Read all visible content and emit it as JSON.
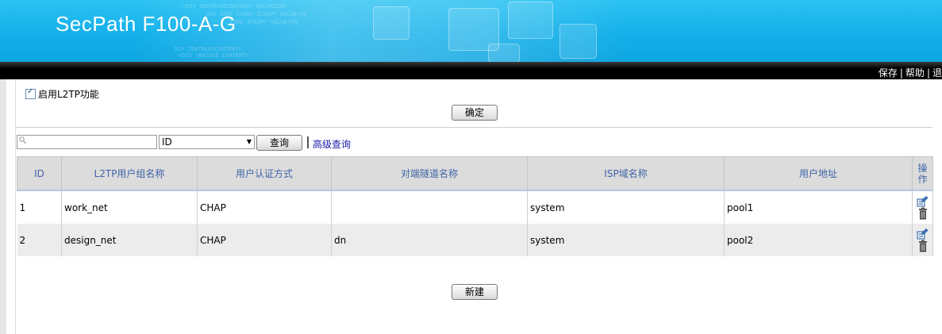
{
  "banner": {
    "product_title": "SecPath F100-A-G"
  },
  "topbar": {
    "links": [
      "保存",
      "帮助",
      "退"
    ]
  },
  "l2tp": {
    "enable_label": "启用L2TP功能",
    "enabled": true,
    "confirm_label": "确定"
  },
  "search": {
    "placeholder": "",
    "field_selected": "ID",
    "query_label": "查询",
    "advanced_label": "高级查询"
  },
  "table": {
    "headers": [
      "ID",
      "L2TP用户组名称",
      "用户认证方式",
      "对端隧道名称",
      "ISP域名称",
      "用户地址",
      "操作"
    ],
    "rows": [
      {
        "id": "1",
        "group": "work_net",
        "auth": "CHAP",
        "tunnel": "",
        "isp": "system",
        "addr": "pool1"
      },
      {
        "id": "2",
        "group": "design_net",
        "auth": "CHAP",
        "tunnel": "dn",
        "isp": "system",
        "addr": "pool2"
      }
    ]
  },
  "actions": {
    "new_label": "新建"
  },
  "icons": {
    "edit": "edit-icon",
    "delete": "trash-icon",
    "search": "search-icon",
    "dropdown": "chevron-down-icon"
  },
  "colors": {
    "banner": "#14b0ea",
    "header_text": "#3f63a8",
    "link": "#1a1aa6"
  }
}
